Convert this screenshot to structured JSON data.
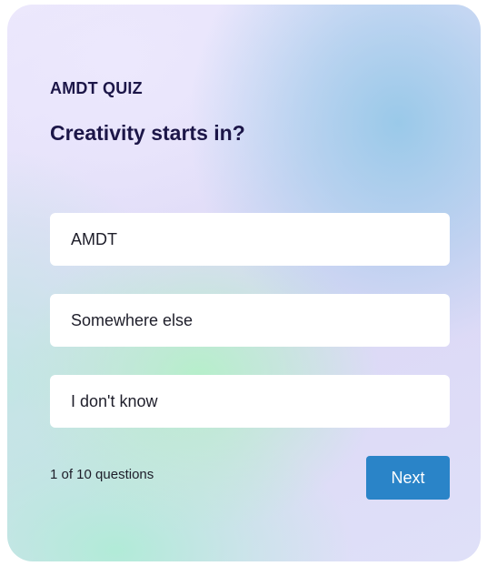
{
  "quiz": {
    "label": "AMDT QUIZ",
    "question": "Creativity starts in?",
    "options": [
      {
        "label": "AMDT"
      },
      {
        "label": "Somewhere else"
      },
      {
        "label": "I don't know"
      }
    ],
    "progress_text": "1 of 10 questions",
    "next_label": "Next"
  },
  "colors": {
    "accent": "#2a84c8",
    "heading": "#1c1648",
    "option_background": "#ffffff"
  }
}
